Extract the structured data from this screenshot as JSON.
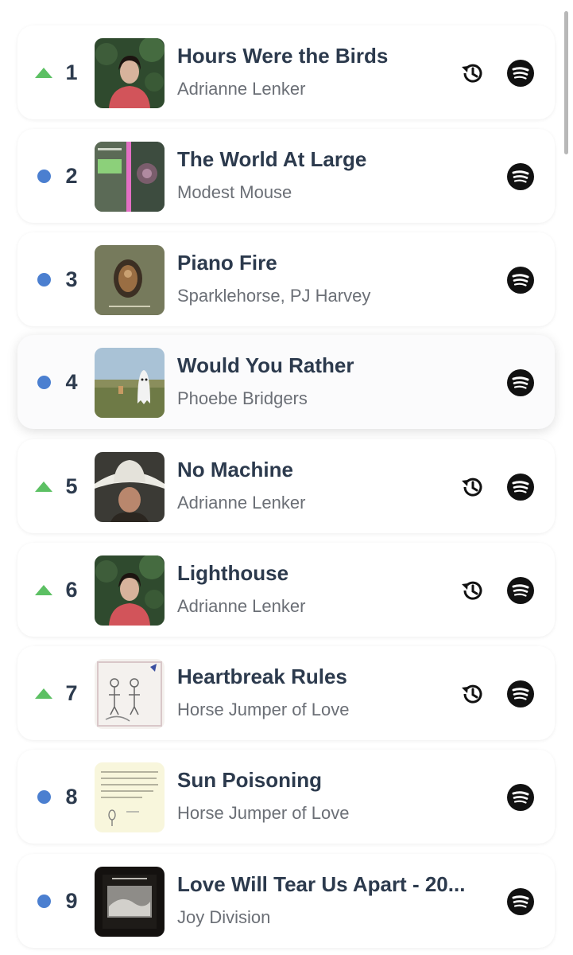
{
  "colors": {
    "trend_up": "#5cc063",
    "trend_same": "#4b7fd0",
    "title_text": "#2c3a4d",
    "artist_text": "#6b6f76"
  },
  "icons": {
    "history": "history-icon",
    "spotify": "spotify-icon",
    "up": "trend-up-icon",
    "same": "trend-same-icon"
  },
  "tracks": [
    {
      "rank": "1",
      "trend": "up",
      "title": "Hours Were the Birds",
      "artist": "Adrianne Lenker",
      "history": true
    },
    {
      "rank": "2",
      "trend": "same",
      "title": "The World At Large",
      "artist": "Modest Mouse",
      "history": false
    },
    {
      "rank": "3",
      "trend": "same",
      "title": "Piano Fire",
      "artist": "Sparklehorse, PJ Harvey",
      "history": false
    },
    {
      "rank": "4",
      "trend": "same",
      "title": "Would You Rather",
      "artist": "Phoebe Bridgers",
      "history": false
    },
    {
      "rank": "5",
      "trend": "up",
      "title": "No Machine",
      "artist": "Adrianne Lenker",
      "history": true
    },
    {
      "rank": "6",
      "trend": "up",
      "title": "Lighthouse",
      "artist": "Adrianne Lenker",
      "history": true
    },
    {
      "rank": "7",
      "trend": "up",
      "title": "Heartbreak Rules",
      "artist": "Horse Jumper of Love",
      "history": true
    },
    {
      "rank": "8",
      "trend": "same",
      "title": "Sun Poisoning",
      "artist": "Horse Jumper of Love",
      "history": false
    },
    {
      "rank": "9",
      "trend": "same",
      "title": "Love Will Tear Us Apart - 20...",
      "artist": "Joy Division",
      "history": false
    }
  ]
}
